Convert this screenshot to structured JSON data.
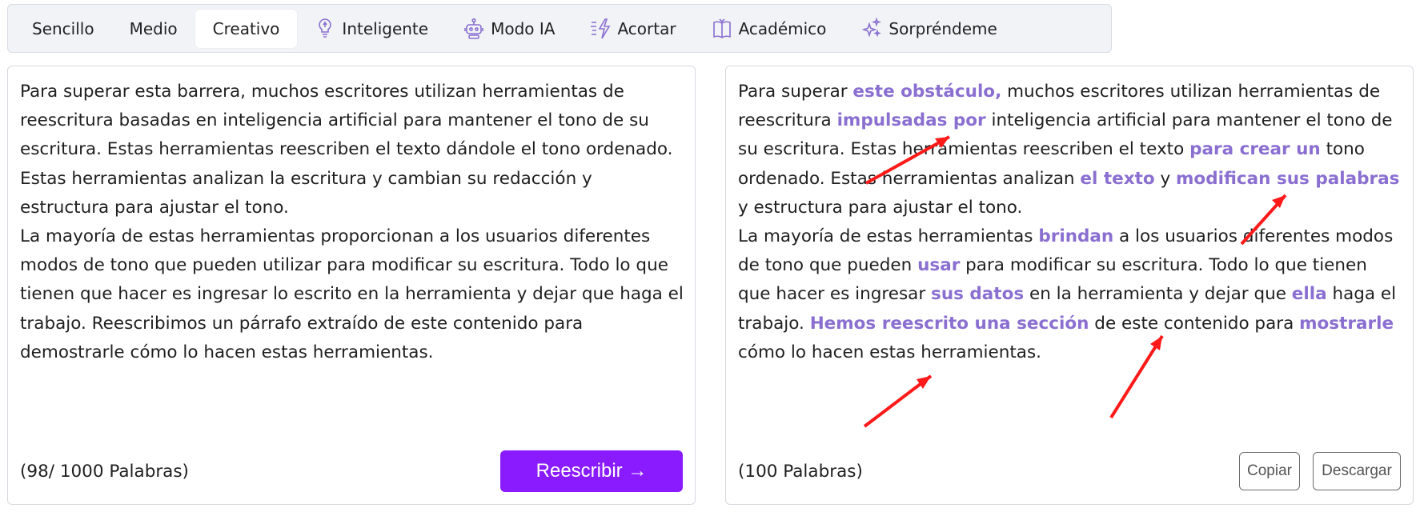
{
  "tabs": [
    {
      "label": "Sencillo",
      "icon": "",
      "active": false
    },
    {
      "label": "Medio",
      "icon": "",
      "active": false
    },
    {
      "label": "Creativo",
      "icon": "",
      "active": true
    },
    {
      "label": "Inteligente",
      "icon": "lightbulb-icon",
      "active": false
    },
    {
      "label": "Modo IA",
      "icon": "robot-icon",
      "active": false
    },
    {
      "label": "Acortar",
      "icon": "shorten-bolt-icon",
      "active": false
    },
    {
      "label": "Académico",
      "icon": "book-icon",
      "active": false
    },
    {
      "label": "Sorpréndeme",
      "icon": "sparkles-icon",
      "active": false
    }
  ],
  "input_panel": {
    "paragraphs": [
      "Para superar esta barrera, muchos escritores utilizan herramientas de reescritura basadas en inteligencia artificial para mantener el tono de su escritura. Estas herramientas reescriben el texto dándole el tono ordenado. Estas herramientas analizan la escritura y cambian su redacción y estructura para ajustar el tono.",
      "La mayoría de estas herramientas proporcionan a los usuarios diferentes modos de tono que pueden utilizar para modificar su escritura. Todo lo que tienen que hacer es ingresar lo escrito en la herramienta y dejar que haga el trabajo. Reescribimos un párrafo extraído de este contenido para demostrarle cómo lo hacen estas herramientas."
    ],
    "word_count": "(98/ 1000 Palabras)",
    "rewrite_label": "Reescribir →"
  },
  "output_panel": {
    "paragraphs": [
      [
        {
          "t": "Para superar ",
          "h": false
        },
        {
          "t": "este obstáculo,",
          "h": true
        },
        {
          "t": " muchos escritores utilizan herramientas de reescritura ",
          "h": false
        },
        {
          "t": "impulsadas por",
          "h": true
        },
        {
          "t": " inteligencia artificial para mantener el tono de su escritura. Estas herramientas reescriben el texto ",
          "h": false
        },
        {
          "t": "para crear un",
          "h": true
        },
        {
          "t": " tono ordenado. Estas herramientas analizan ",
          "h": false
        },
        {
          "t": "el texto",
          "h": true
        },
        {
          "t": " y ",
          "h": false
        },
        {
          "t": "modifican sus palabras",
          "h": true
        },
        {
          "t": " y estructura para ajustar el tono.",
          "h": false
        }
      ],
      [
        {
          "t": "La mayoría de estas herramientas ",
          "h": false
        },
        {
          "t": "brindan",
          "h": true
        },
        {
          "t": " a los usuarios diferentes modos de tono que pueden ",
          "h": false
        },
        {
          "t": "usar",
          "h": true
        },
        {
          "t": " para modificar su escritura. Todo lo que tienen que hacer es ingresar ",
          "h": false
        },
        {
          "t": "sus datos",
          "h": true
        },
        {
          "t": " en la herramienta y dejar que ",
          "h": false
        },
        {
          "t": "ella",
          "h": true
        },
        {
          "t": " haga el trabajo. ",
          "h": false
        },
        {
          "t": "Hemos reescrito una sección",
          "h": true
        },
        {
          "t": " de este contenido para ",
          "h": false
        },
        {
          "t": "mostrarle",
          "h": true
        },
        {
          "t": " cómo lo hacen estas herramientas.",
          "h": false
        }
      ]
    ],
    "word_count": "(100 Palabras)",
    "copy_label": "Copiar",
    "download_label": "Descargar"
  },
  "colors": {
    "accent_button": "#8a1bff",
    "highlight_text": "#8a6fd1",
    "annotation_arrow": "#ff1a1a"
  }
}
